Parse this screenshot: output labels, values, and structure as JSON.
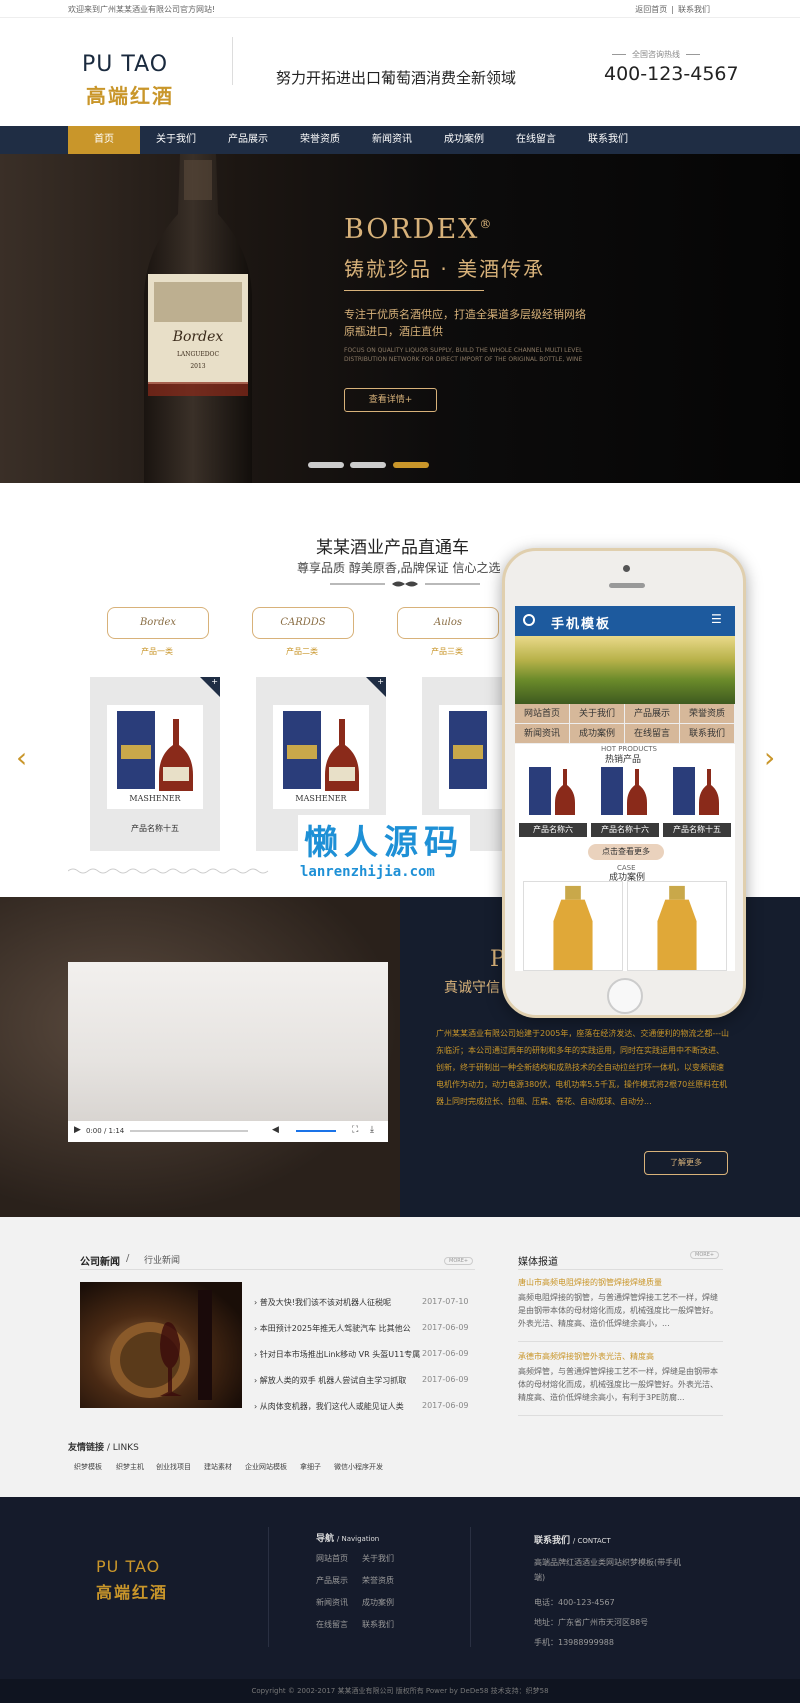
{
  "topbar": {
    "welcome": "欢迎来到广州某某酒业有限公司官方网站!",
    "home": "返回首页",
    "sep": "|",
    "contact": "联系我们"
  },
  "header": {
    "logo_en": "PU TAO",
    "logo_cn": "高端红酒",
    "slogan": "努力开拓进出口葡萄酒消费全新领域",
    "hotline_label": "全国咨询热线",
    "hotline": "400-123-4567"
  },
  "nav": {
    "items": [
      "首页",
      "关于我们",
      "产品展示",
      "荣誉资质",
      "新闻资讯",
      "成功案例",
      "在线留言",
      "联系我们"
    ],
    "active_index": 0
  },
  "banner": {
    "title": "BORDEX",
    "reg": "®",
    "subtitle": "铸就珍品 · 美酒传承",
    "text1": "专注于优质名酒供应，打造全渠道多层级经销网络",
    "text2": "原瓶进口，酒庄直供",
    "en1": "FOCUS ON QUALITY LIQUOR SUPPLY, BUILD THE WHOLE CHANNEL MULTI LEVEL",
    "en2": "DISTRIBUTION NETWORK FOR DIRECT IMPORT OF THE ORIGINAL BOTTLE, WINE",
    "button": "查看详情+",
    "slides": 3,
    "active_slide": 2,
    "bottle_label1": "Bordex",
    "bottle_label2": "LANGUEDOC",
    "bottle_year": "2013"
  },
  "products": {
    "title": "某某酒业产品直通车",
    "subtitle": "尊享品质 醇美原香,品牌保证 信心之选",
    "categories": [
      {
        "name": "Bordex",
        "label": "产品一类"
      },
      {
        "name": "CARDDS",
        "label": "产品二类"
      },
      {
        "name": "Aulos",
        "label": "产品三类"
      }
    ],
    "items": [
      "产品名称十五",
      "",
      ""
    ],
    "box_brand": "MASHENER"
  },
  "watermark": {
    "cn": "懒人源码",
    "en": "lanrenzhijia.com"
  },
  "phone": {
    "title": "手机模板",
    "nav": [
      "网站首页",
      "关于我们",
      "产品展示",
      "荣誉资质",
      "新闻资讯",
      "成功案例",
      "在线留言",
      "联系我们"
    ],
    "hot_en": "HOT PRODUCTS",
    "hot": "热销产品",
    "products": [
      "产品名称六",
      "产品名称十六",
      "产品名称十五"
    ],
    "more": "点击查看更多",
    "case_en": "CASE",
    "case": "成功案例"
  },
  "about": {
    "p": "P",
    "title": "真诚守信",
    "text": "广州某某酒业有限公司始建于2005年，座落在经济发达、交通便利的物流之都---山东临沂；本公司通过两年的研制和多年的实践运用，同时在实践运用中不断改进、创新，终于研制出一种全新结构和成熟技术的全自动拉丝打环一体机，以变频调速电机作为动力，动力电源380伏，电机功率5.5千瓦，操作模式将2根70丝原料在机器上同时完成拉长、拉细、压扁、卷花、自动成球、自动分...",
    "button": "了解更多",
    "video_time": "0:00 / 1:14"
  },
  "news": {
    "tab1": "公司新闻",
    "slash": "/",
    "tab2": "行业新闻",
    "more": "MORE+",
    "items": [
      {
        "title": "普及大快!我们该不该对机器人征税呢",
        "date": "2017-07-10"
      },
      {
        "title": "本田预计2025年推无人驾驶汽车 比其他公",
        "date": "2017-06-09"
      },
      {
        "title": "针对日本市场推出Link移动 VR 头盔U11专属",
        "date": "2017-06-09"
      },
      {
        "title": "解放人类的双手 机器人尝试自主学习抓取",
        "date": "2017-06-09"
      },
      {
        "title": "从肉体变机器，我们这代人或能见证人类",
        "date": "2017-06-09"
      }
    ],
    "media_title": "媒体报道",
    "media": [
      {
        "title": "唐山市高频电阻焊接的钢管焊接焊缝质量",
        "text": "高频电阻焊接的钢管，与普通焊管焊接工艺不一样，焊缝是由钢带本体的母材熔化而成，机械强度比一般焊管好。外表光洁、精度高、造价低焊缝余高小，..."
      },
      {
        "title": "承德市高频焊接钢管外表光洁、精度高",
        "text": "高频焊管，与普通焊管焊接工艺不一样，焊缝是由钢带本体的母材熔化而成，机械强度比一般焊管好。外表光洁、精度高、造价低焊缝余高小，有利于3PE防腐..."
      }
    ],
    "links_title": "友情链接",
    "links_en": "/ LINKS",
    "links": [
      "织梦模板",
      "织梦主机",
      "创业找项目",
      "建站素材",
      "企业网站模板",
      "拿细子",
      "微信小程序开发"
    ]
  },
  "footer": {
    "logo_en": "PU TAO",
    "logo_cn": "高端红酒",
    "nav_title": "导航",
    "nav_title_en": "/ Navigation",
    "nav": [
      "网站首页",
      "关于我们",
      "产品展示",
      "荣誉资质",
      "新闻资讯",
      "成功案例",
      "在线留言",
      "联系我们"
    ],
    "contact_title": "联系我们",
    "contact_title_en": "/ CONTACT",
    "company": "高端品牌红酒酒业类网站织梦模板(带手机端)",
    "phone": "电话：400-123-4567",
    "address": "地址：广东省广州市天河区88号",
    "mobile": "手机：13988999988",
    "copyright": "Copyright © 2002-2017 某某酒业有限公司 版权所有 Power by DeDe58 技术支持：织梦58"
  },
  "colors": {
    "gold": "#c9962a",
    "navy": "#1f2d44",
    "phone_blue": "#1d5a9e",
    "watermark": "#1e90d6"
  }
}
